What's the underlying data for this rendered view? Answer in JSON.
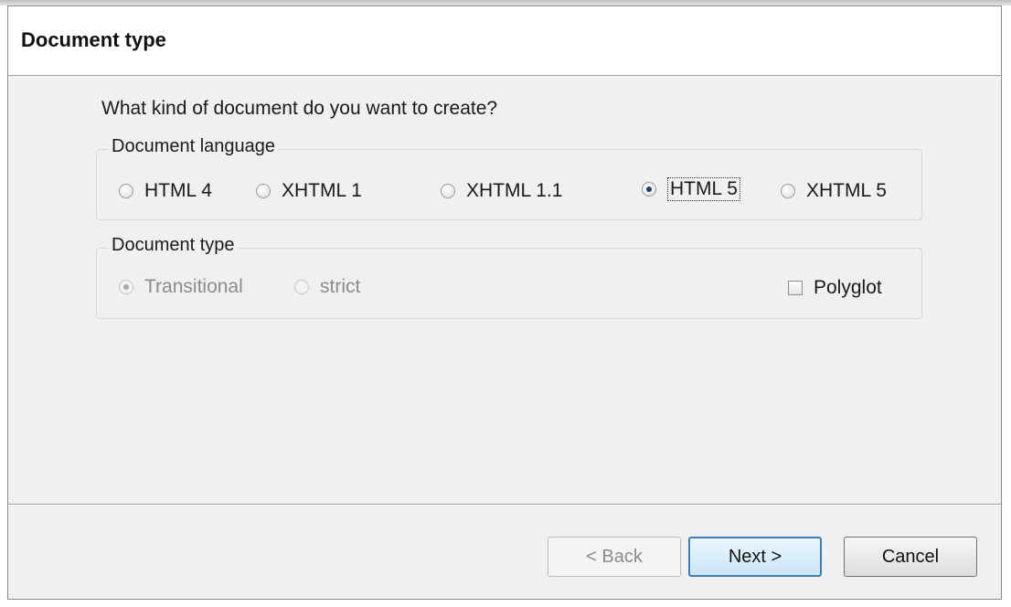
{
  "header": {
    "title": "Document type"
  },
  "question": "What kind of document do you want to create?",
  "language_group": {
    "legend": "Document language",
    "options": [
      {
        "label": "HTML 4",
        "checked": false
      },
      {
        "label": "XHTML 1",
        "checked": false
      },
      {
        "label": "XHTML 1.1",
        "checked": false
      },
      {
        "label": "HTML 5",
        "checked": true
      },
      {
        "label": "XHTML 5",
        "checked": false
      }
    ]
  },
  "type_group": {
    "legend": "Document type",
    "options": [
      {
        "label": "Transitional",
        "checked": true,
        "enabled": false
      },
      {
        "label": "strict",
        "checked": false,
        "enabled": false
      }
    ],
    "polyglot": {
      "label": "Polyglot",
      "checked": false
    }
  },
  "buttons": {
    "back": "< Back",
    "next": "Next >",
    "cancel": "Cancel"
  },
  "colors": {
    "accent": "#3c7fb1",
    "panel": "#f0f0f0",
    "disabled_text": "#8c8c8c"
  }
}
